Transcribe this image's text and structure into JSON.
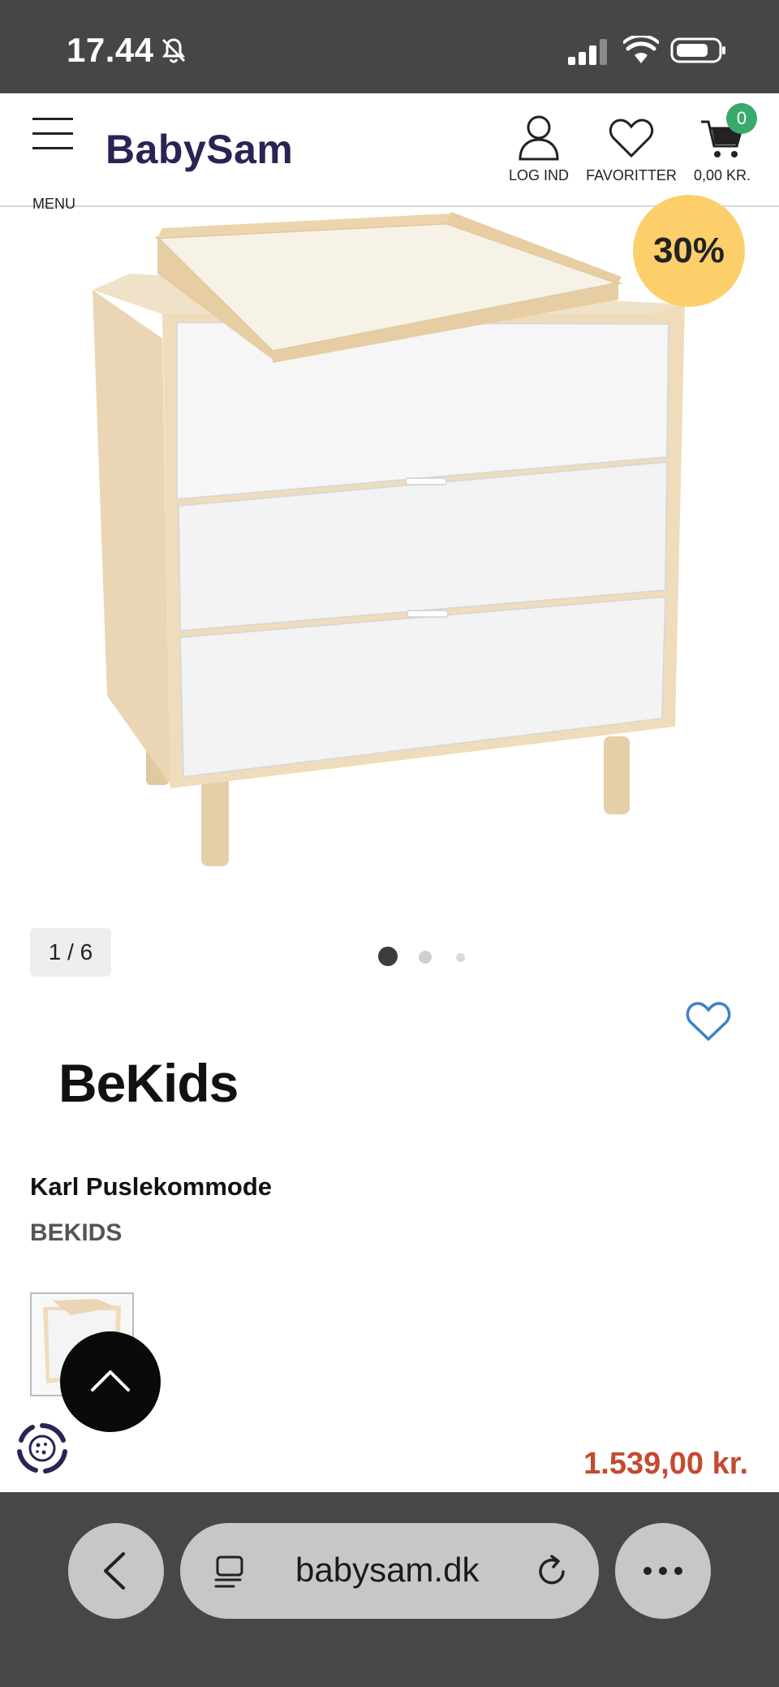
{
  "status_bar": {
    "time": "17.44"
  },
  "header": {
    "menu_label": "MENU",
    "logo": "BabySam",
    "login_label": "LOG IND",
    "favorites_label": "FAVORITTER",
    "cart_total": "0,00 KR.",
    "cart_count": "0"
  },
  "product": {
    "discount": "30%",
    "image_counter": "1 / 6",
    "carousel_dots": 3,
    "active_dot": 1,
    "brand_logo": "BeKids",
    "title": "Karl Puslekommode",
    "brand": "BEKIDS",
    "price": "1.539,00 kr."
  },
  "browser": {
    "url": "babysam.dk"
  },
  "colors": {
    "status_bg": "#464646",
    "logo": "#2a2456",
    "cart_badge": "#3aa96b",
    "discount_badge": "#fccf6b",
    "price": "#c44a30",
    "heart_outline": "#3b82c4"
  }
}
